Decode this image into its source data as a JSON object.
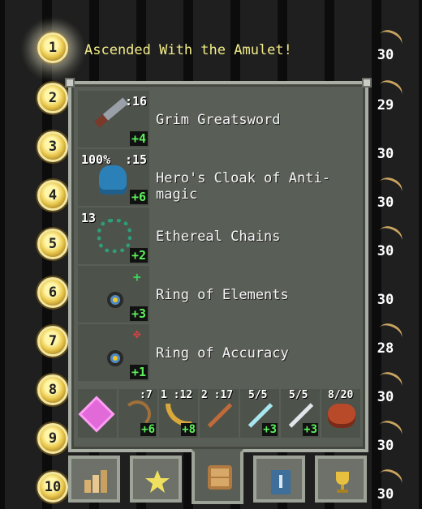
{
  "rankings": [
    {
      "rank": "1",
      "score": "30"
    },
    {
      "rank": "2",
      "score": "29"
    },
    {
      "rank": "3",
      "score": "30"
    },
    {
      "rank": "4",
      "score": "30"
    },
    {
      "rank": "5",
      "score": "30"
    },
    {
      "rank": "6",
      "score": "30"
    },
    {
      "rank": "7",
      "score": "28"
    },
    {
      "rank": "8",
      "score": "30"
    },
    {
      "rank": "9",
      "score": "30"
    },
    {
      "rank": "10",
      "score": "30"
    }
  ],
  "first_entry": {
    "text": "Ascended With the Amulet!"
  },
  "colors": {
    "title_yellow": "#f2ec8a",
    "enchant_green": "#5cf05c",
    "panel_bg": "#595e56",
    "panel_border": "#a9aea4"
  },
  "items": [
    {
      "name": "Grim Greatsword",
      "qty_top": ":16",
      "enchant": "+4",
      "icon": "sword-icon"
    },
    {
      "name": "Hero's Cloak of Anti-magic",
      "qty_left": "100%",
      "qty_top": ":15",
      "enchant": "+6",
      "icon": "cloak-icon"
    },
    {
      "name": "Ethereal Chains",
      "qty_left": "13",
      "enchant": "+2",
      "icon": "chains-icon"
    },
    {
      "name": "Ring of Elements",
      "enchant": "+3",
      "icon": "ring-icon",
      "glyph": "+"
    },
    {
      "name": "Ring of Accuracy",
      "enchant": "+1",
      "icon": "ring-icon",
      "glyph": "✥"
    }
  ],
  "quiver": [
    {
      "icon": "gem-icon"
    },
    {
      "qty": ":7",
      "enchant": "+6",
      "icon": "bow-icon"
    },
    {
      "qty": "1 :12",
      "enchant": "+8",
      "icon": "boomerang-icon"
    },
    {
      "qty": "2 :17",
      "icon": "wand-icon"
    },
    {
      "qty": "5/5",
      "enchant": "+3",
      "icon": "wand-icon"
    },
    {
      "qty": "5/5",
      "enchant": "+3",
      "icon": "wand-icon"
    },
    {
      "qty": "8/20",
      "icon": "satchel-icon"
    }
  ],
  "tabs": [
    {
      "icon": "stats-icon"
    },
    {
      "icon": "badges-icon"
    },
    {
      "icon": "backpack-icon",
      "active": true
    },
    {
      "icon": "journal-icon"
    },
    {
      "icon": "trophy-icon"
    }
  ]
}
